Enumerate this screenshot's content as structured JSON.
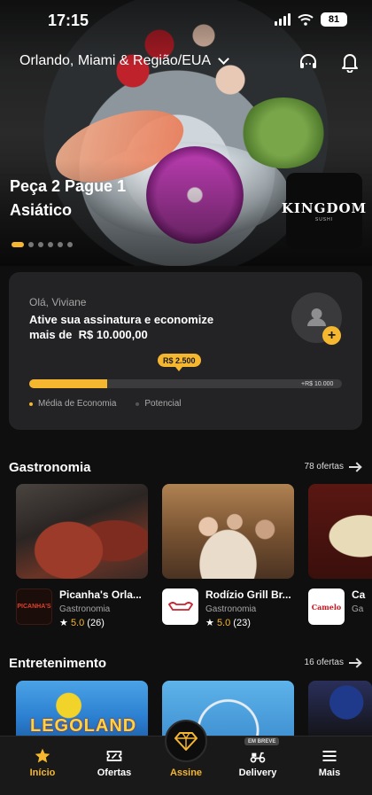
{
  "status": {
    "time": "17:15",
    "battery": "81"
  },
  "header": {
    "location": "Orlando, Miami & Região/EUA"
  },
  "promo": {
    "title_line1": "Peça 2 Pague 1",
    "title_line2": "Asiático",
    "brand_word": "KINGDOM",
    "brand_sub": "SUSHI",
    "slide_count": 6,
    "active_slide": 1
  },
  "subscription": {
    "greeting": "Olá, Viviane",
    "message_line1": "Ative sua assinatura e economize",
    "message_line2": "mais de",
    "amount": "R$ 10.000,00",
    "current_value_label": "R$ 2.500",
    "max_value_label": "+R$ 10.000",
    "progress_fraction": 0.25,
    "legend_average": "Média de Economia",
    "legend_potential": "Potencial",
    "colors": {
      "accent": "#f5b730"
    }
  },
  "gastronomia": {
    "title": "Gastronomia",
    "count": "78 ofertas",
    "items": [
      {
        "name": "Picanha's Orla...",
        "category": "Gastronomia",
        "score": "5.0",
        "reviews": "(26)",
        "logo": "PICANHA'S"
      },
      {
        "name": "Rodízio Grill Br...",
        "category": "Gastronomia",
        "score": "5.0",
        "reviews": "(23)"
      },
      {
        "name": "Ca",
        "category": "Ga",
        "logo": "Camelo"
      }
    ]
  },
  "entretenimento": {
    "title": "Entretenimento",
    "count": "16 ofertas",
    "items": [
      {
        "label": "LEGOLAND"
      },
      {
        "label": ""
      },
      {
        "label": ""
      }
    ]
  },
  "tabbar": {
    "items": [
      "Início",
      "Ofertas",
      "Assine",
      "Delivery",
      "Mais"
    ],
    "badge": "EM BREVE"
  }
}
